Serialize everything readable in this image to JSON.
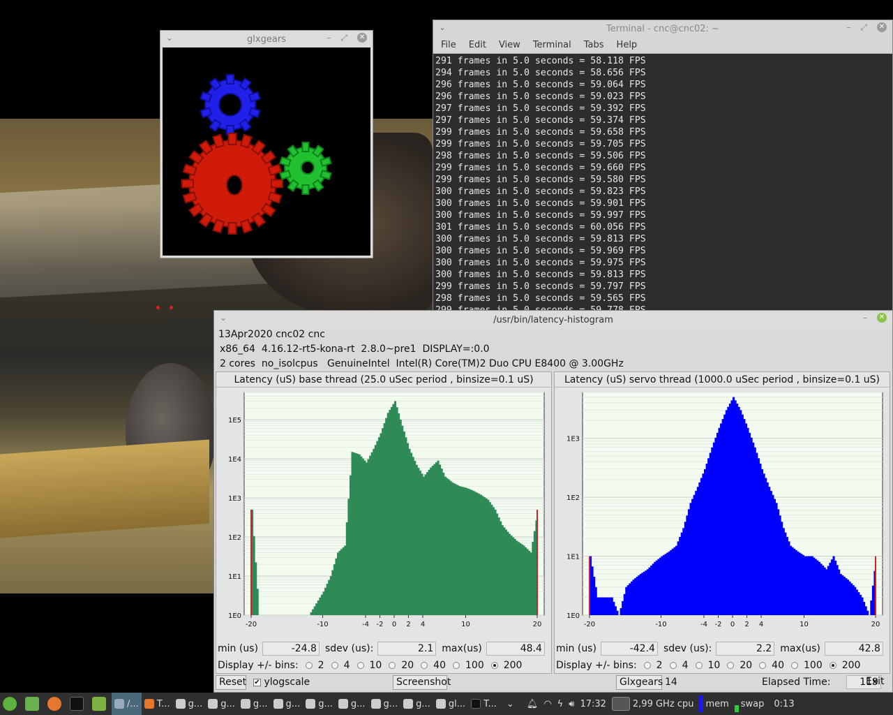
{
  "glxgears": {
    "title": "glxgears"
  },
  "terminal": {
    "title": "Terminal - cnc@cnc02: ~",
    "menu": [
      "File",
      "Edit",
      "View",
      "Terminal",
      "Tabs",
      "Help"
    ],
    "lines": [
      "291 frames in 5.0 seconds = 58.118 FPS",
      "294 frames in 5.0 seconds = 58.656 FPS",
      "296 frames in 5.0 seconds = 59.064 FPS",
      "296 frames in 5.0 seconds = 59.023 FPS",
      "297 frames in 5.0 seconds = 59.392 FPS",
      "297 frames in 5.0 seconds = 59.374 FPS",
      "299 frames in 5.0 seconds = 59.658 FPS",
      "299 frames in 5.0 seconds = 59.705 FPS",
      "298 frames in 5.0 seconds = 59.506 FPS",
      "299 frames in 5.0 seconds = 59.660 FPS",
      "299 frames in 5.0 seconds = 59.580 FPS",
      "300 frames in 5.0 seconds = 59.823 FPS",
      "300 frames in 5.0 seconds = 59.901 FPS",
      "300 frames in 5.0 seconds = 59.997 FPS",
      "301 frames in 5.0 seconds = 60.056 FPS",
      "300 frames in 5.0 seconds = 59.813 FPS",
      "300 frames in 5.0 seconds = 59.969 FPS",
      "300 frames in 5.0 seconds = 59.975 FPS",
      "300 frames in 5.0 seconds = 59.813 FPS",
      "299 frames in 5.0 seconds = 59.797 FPS",
      "298 frames in 5.0 seconds = 59.565 FPS",
      "299 frames in 5.0 seconds = 59.778 FPS"
    ]
  },
  "latency": {
    "title": "/usr/bin/latency-histogram",
    "info1": "13Apr2020 cnc02 cnc",
    "info2": "x86_64  4.16.12-rt5-kona-rt  2.8.0~pre1  DISPLAY=:0.0",
    "info3": "2 cores  no_isolcpus   GenuineIntel  Intel(R) Core(TM)2 Duo CPU E8400 @ 3.00GHz",
    "base": {
      "title": "Latency (uS) base thread (25.0 uSec period , binsize=0.1 uS)",
      "min_label": "min (us)",
      "min": "-24.8",
      "sdev_label": "sdev (us):",
      "sdev": "2.1",
      "max_label": "max(us)",
      "max": "48.4"
    },
    "servo": {
      "title": "Latency (uS) servo thread (1000.0 uSec period , binsize=0.1 uS)",
      "min_label": "min (us)",
      "min": "-42.4",
      "sdev_label": "sdev (us):",
      "sdev": "2.2",
      "max_label": "max(us)",
      "max": "42.8"
    },
    "bins_label": "Display +/- bins:",
    "bins_options": [
      "2",
      "4",
      "10",
      "20",
      "40",
      "100",
      "200"
    ],
    "bins_selected": "200",
    "reset": "Reset",
    "ylogscale": "ylogscale",
    "screenshot": "Screenshot",
    "glxgears_btn": "Glxgears",
    "glxgears_count": "14",
    "elapsed_label": "Elapsed Time:",
    "elapsed": "119",
    "exit": "Exit"
  },
  "chart_data": [
    {
      "type": "bar",
      "title": "Latency (uS) base thread (25.0 uSec period , binsize=0.1 uS)",
      "color": "#2e8b57",
      "yscale": "log",
      "xticks": [
        "-20",
        "-10",
        "-4",
        "-2",
        "0",
        "2",
        "4",
        "10",
        "20"
      ],
      "yticks": [
        "1E0",
        "1E1",
        "1E2",
        "1E3",
        "1E4",
        "1E5"
      ],
      "xlim": [
        -20,
        20
      ],
      "ylim": [
        1,
        500000
      ],
      "x": [
        -20,
        -19,
        -18,
        -17,
        -16,
        -15,
        -14,
        -13,
        -12,
        -11,
        -10,
        -9,
        -8,
        -7,
        -6,
        -5,
        -4,
        -3,
        -2,
        -1,
        0,
        1,
        2,
        3,
        4,
        5,
        6,
        7,
        8,
        9,
        10,
        11,
        12,
        13,
        14,
        15,
        16,
        17,
        18,
        19,
        20
      ],
      "values": [
        500,
        1,
        1,
        1,
        1,
        1,
        1,
        1,
        1,
        2,
        4,
        10,
        40,
        60,
        15000,
        13000,
        8000,
        18000,
        45000,
        150000,
        300000,
        70000,
        18000,
        7000,
        3500,
        6000,
        9000,
        3500,
        2500,
        2000,
        1800,
        1500,
        1200,
        900,
        500,
        200,
        120,
        80,
        60,
        40,
        500
      ]
    },
    {
      "type": "bar",
      "title": "Latency (uS) servo thread (1000.0 uSec period , binsize=0.1 uS)",
      "color": "#0000ff",
      "yscale": "log",
      "xticks": [
        "-20",
        "-10",
        "-4",
        "-2",
        "0",
        "2",
        "4",
        "10",
        "20"
      ],
      "yticks": [
        "1E0",
        "1E1",
        "1E2",
        "1E3"
      ],
      "xlim": [
        -20,
        20
      ],
      "ylim": [
        1,
        6000
      ],
      "x": [
        -20,
        -19,
        -18,
        -17,
        -16,
        -15,
        -14,
        -13,
        -12,
        -11,
        -10,
        -9,
        -8,
        -7,
        -6,
        -5,
        -4,
        -3,
        -2,
        -1,
        0,
        1,
        2,
        3,
        4,
        5,
        6,
        7,
        8,
        9,
        10,
        11,
        12,
        13,
        14,
        15,
        16,
        17,
        18,
        19,
        20
      ],
      "values": [
        10,
        2,
        2,
        2,
        1,
        3,
        4,
        5,
        6,
        8,
        10,
        12,
        15,
        30,
        80,
        150,
        300,
        700,
        1500,
        3000,
        5000,
        3000,
        1500,
        700,
        300,
        150,
        80,
        30,
        15,
        12,
        10,
        10,
        8,
        6,
        10,
        5,
        4,
        3,
        2,
        1,
        10
      ]
    }
  ],
  "taskbar": {
    "items": [
      "/...",
      "T...",
      "g...",
      "g...",
      "g...",
      "g...",
      "g...",
      "g...",
      "g...",
      "g...",
      "gl...",
      "T..."
    ],
    "clock": "17:32",
    "cpu_freq": "2,99 GHz",
    "cpu_label": "cpu",
    "mem_label": "mem",
    "swap_label": "swap",
    "uptime": "0:13"
  }
}
